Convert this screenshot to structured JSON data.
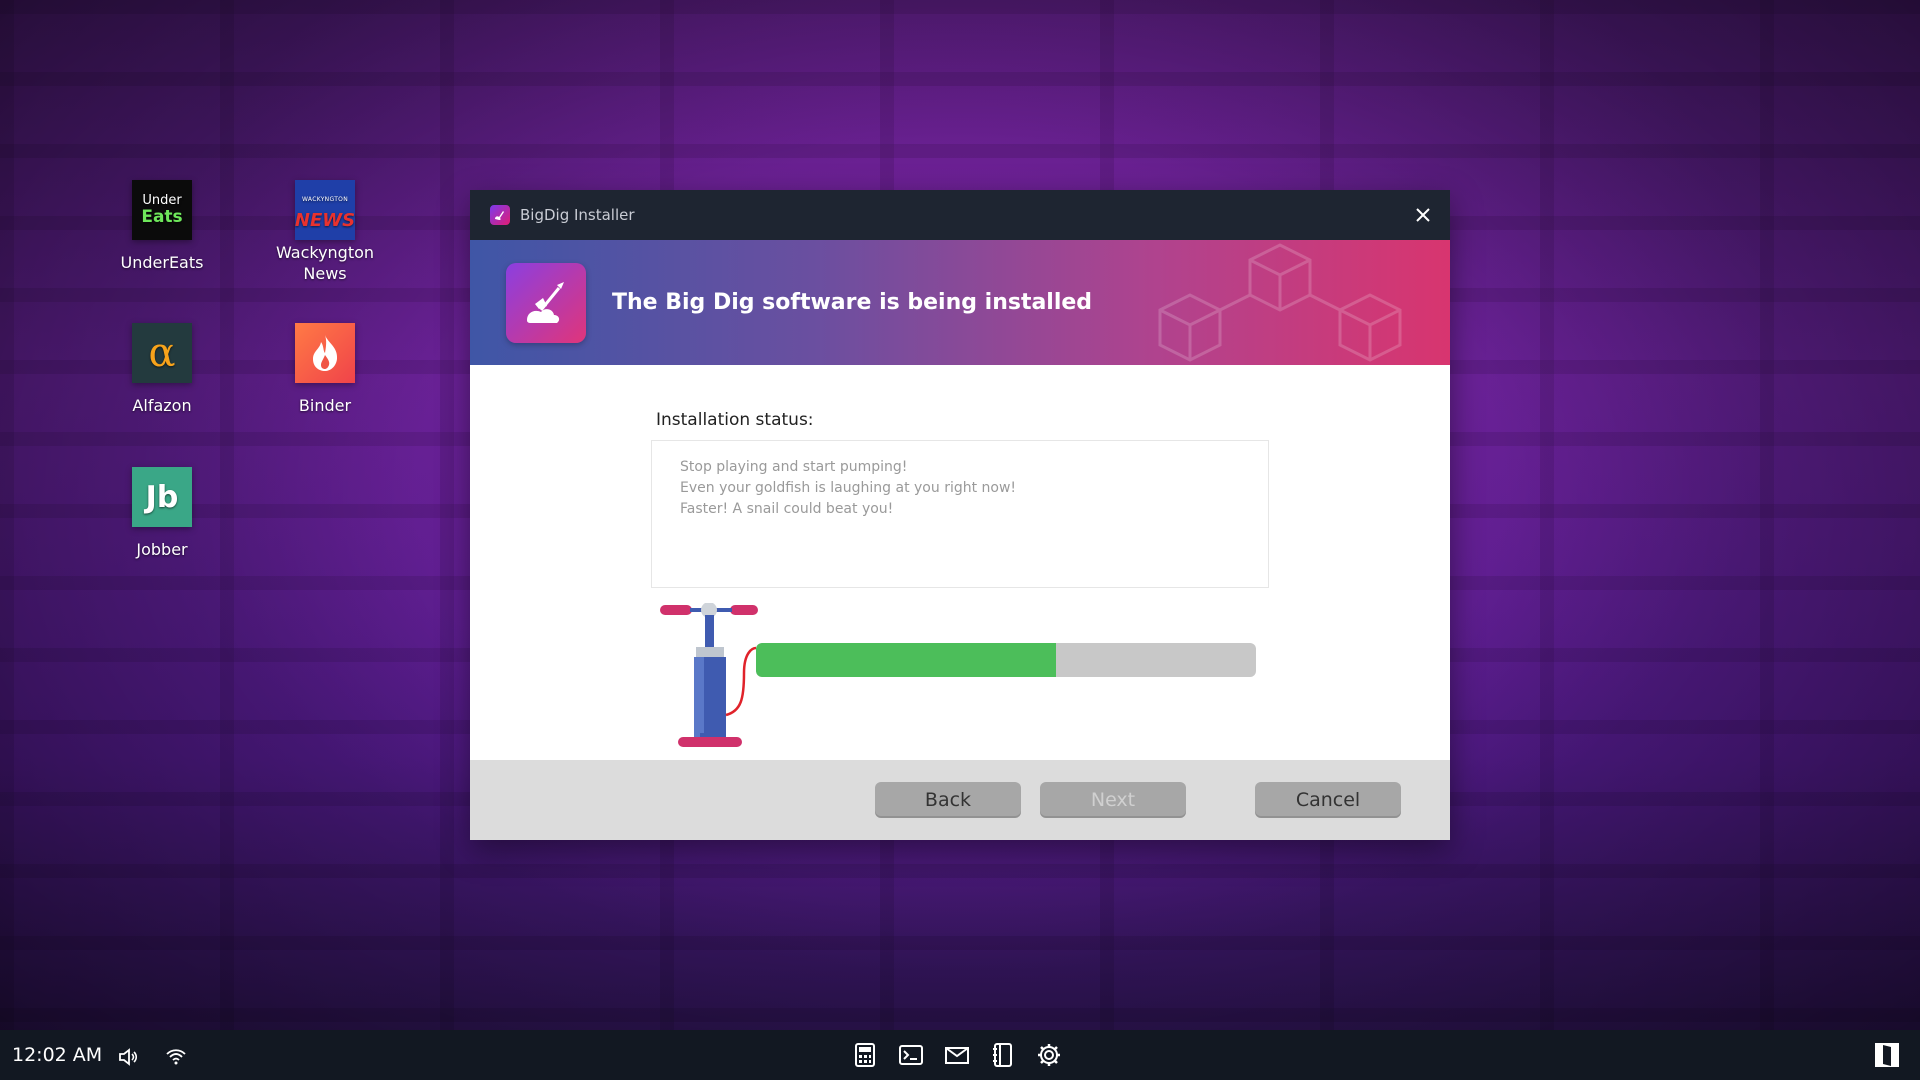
{
  "desktop": {
    "icons": [
      {
        "label": "UnderEats",
        "tile_line1": "Under",
        "tile_line2": "Eats"
      },
      {
        "label_line1": "Wackyngton",
        "label_line2": "News",
        "tile_top": "WACKYNGTON",
        "tile_main": "NEWS"
      },
      {
        "label": "Alfazon",
        "glyph": "α"
      },
      {
        "label": "Binder"
      },
      {
        "label": "Jobber",
        "glyph": "Jb"
      }
    ]
  },
  "window": {
    "title": "BigDig Installer",
    "banner_title": "The Big Dig software is being installed",
    "status_label": "Installation status:",
    "status_lines": [
      "Stop playing and start pumping!",
      "Even your goldfish is laughing at you right now!",
      "Faster! A snail could beat you!"
    ],
    "progress_fraction": 0.6,
    "buttons": {
      "back": "Back",
      "next": "Next",
      "cancel": "Cancel"
    }
  },
  "taskbar": {
    "time": "12:02 AM",
    "icons": [
      "volume-icon",
      "wifi-icon",
      "calculator-icon",
      "terminal-icon",
      "mail-icon",
      "notebook-icon",
      "settings-icon",
      "start-icon"
    ]
  },
  "colors": {
    "progress_fill": "#4cbe5a",
    "progress_track": "#c8c8c8",
    "titlebar": "#1e2531",
    "banner_start": "#3f56a6",
    "banner_end": "#d8356f"
  }
}
